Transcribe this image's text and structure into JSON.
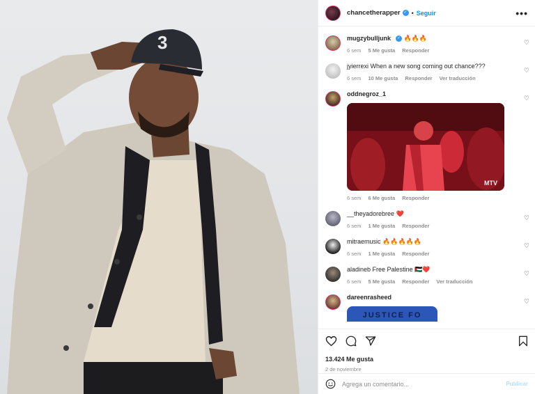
{
  "header": {
    "username": "chancetherapper",
    "verified_mark": "✓",
    "separator": "•",
    "follow_label": "Seguir",
    "more_label": "•••"
  },
  "comments": [
    {
      "username": "mugzybulljunk",
      "verified_mark": "✓",
      "text": "🔥🔥🔥",
      "meta": [
        "6 sem",
        "5 Me gusta",
        "Responder"
      ]
    },
    {
      "username": "jyierrexi",
      "text": "When a new song coming out chance???",
      "meta": [
        "6 sem",
        "10 Me gusta",
        "Responder",
        "Ver traducción"
      ]
    },
    {
      "username": "oddnegroz_1",
      "text": "",
      "meta": [
        "6 sem",
        "6 Me gusta",
        "Responder"
      ],
      "gif_overlay": "MTV"
    },
    {
      "username": "__theyadorebree",
      "text": "❤️",
      "meta": [
        "6 sem",
        "1 Me gusta",
        "Responder"
      ]
    },
    {
      "username": "mitraemusic",
      "text": "🔥🔥🔥🔥🔥",
      "meta": [
        "6 sem",
        "1 Me gusta",
        "Responder"
      ]
    },
    {
      "username": "aladineb",
      "text": "Free Palestine 🇵🇸❤️",
      "meta": [
        "6 sem",
        "5 Me gusta",
        "Responder",
        "Ver traducción"
      ]
    },
    {
      "username": "dareenrasheed",
      "text": "",
      "sticker_text": "JUSTICE FO"
    }
  ],
  "heart_glyph": "♡",
  "footer": {
    "likes": "13.424 Me gusta",
    "date": "2 de noviembre",
    "comment_placeholder": "Agrega un comentario...",
    "post_label": "Publicar"
  },
  "colors": {
    "accent": "#0095f6",
    "post_disabled": "#b2dffc",
    "muted": "#8e8e8e"
  },
  "icons": [
    "more-icon",
    "heart-icon",
    "comment-icon",
    "share-icon",
    "bookmark-icon",
    "emoji-icon"
  ]
}
